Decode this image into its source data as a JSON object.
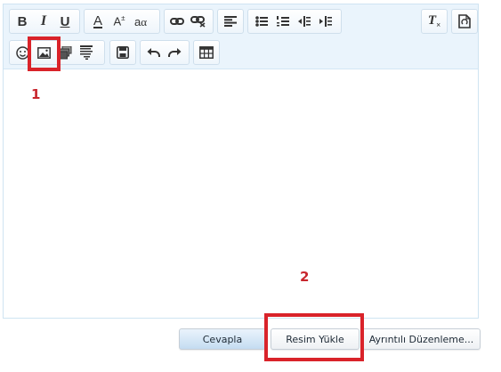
{
  "toolbar": {
    "row1": [
      {
        "icon": "bold-icon",
        "text": "B"
      },
      {
        "icon": "italic-icon",
        "text": "I"
      },
      {
        "icon": "underline-icon",
        "text": "U"
      },
      {
        "icon": "font-color-icon",
        "text": "A"
      },
      {
        "icon": "font-size-icon",
        "text": "A"
      },
      {
        "icon": "font-family-icon",
        "text": "a"
      },
      {
        "icon": "link-icon"
      },
      {
        "icon": "unlink-icon"
      },
      {
        "icon": "align-left-icon"
      },
      {
        "icon": "bulleted-list-icon"
      },
      {
        "icon": "numbered-list-icon"
      },
      {
        "icon": "outdent-icon"
      },
      {
        "icon": "indent-icon"
      },
      {
        "icon": "remove-format-icon",
        "text": "T"
      },
      {
        "icon": "toggle-source-icon"
      }
    ],
    "row2": [
      {
        "icon": "smilie-icon"
      },
      {
        "icon": "insert-image-icon"
      },
      {
        "icon": "insert-media-icon"
      },
      {
        "icon": "insert-quote-icon"
      },
      {
        "icon": "save-draft-icon"
      },
      {
        "icon": "undo-icon"
      },
      {
        "icon": "redo-icon"
      },
      {
        "icon": "insert-table-icon"
      }
    ]
  },
  "annotations": {
    "label_1": "1",
    "label_2": "2",
    "color": "#d9232a"
  },
  "actions": {
    "reply_label": "Cevapla",
    "upload_image_label": "Resim Yükle",
    "advanced_edit_label": "Ayrıntılı Düzenleme..."
  }
}
